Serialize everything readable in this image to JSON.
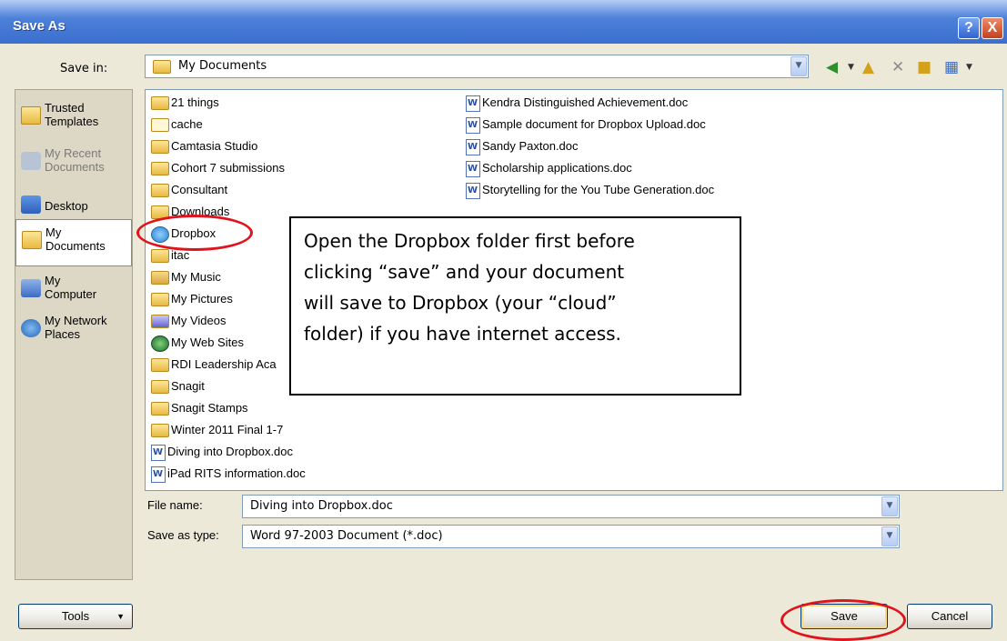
{
  "window": {
    "title": "Save As",
    "help_label": "?",
    "close_label": "X"
  },
  "save_in": {
    "label": "Save in:",
    "value": "My Documents"
  },
  "toolbar": {
    "back_icon": "back-icon",
    "up_icon": "up-folder-icon",
    "delete_icon": "delete-icon",
    "new_folder_icon": "new-folder-icon",
    "views_icon": "views-icon"
  },
  "places": [
    {
      "line1": "Trusted",
      "line2": "Templates"
    },
    {
      "line1": "My Recent",
      "line2": "Documents"
    },
    {
      "line1": "Desktop",
      "line2": ""
    },
    {
      "line1": "My",
      "line2": "Documents"
    },
    {
      "line1": "My",
      "line2": "Computer"
    },
    {
      "line1": "My Network",
      "line2": "Places"
    }
  ],
  "files_left": [
    "21 things",
    "cache",
    "Camtasia Studio",
    "Cohort 7 submissions",
    "Consultant",
    "Downloads",
    "Dropbox",
    "itac",
    "My Music",
    "My Pictures",
    "My Videos",
    "My Web Sites",
    "RDI Leadership Aca",
    "Snagit",
    "Snagit Stamps",
    "Winter 2011 Final 1-7",
    "Diving into Dropbox.doc",
    "iPad RITS information.doc"
  ],
  "files_right": [
    "Kendra Distinguished Achievement.doc",
    "Sample document for Dropbox Upload.doc",
    "Sandy Paxton.doc",
    "Scholarship applications.doc",
    "Storytelling for the You Tube Generation.doc"
  ],
  "callout": {
    "lines": [
      "Open the Dropbox folder first before",
      "clicking “save” and your document",
      "will save to Dropbox (your “cloud”",
      "folder) if you have internet access."
    ]
  },
  "file_name": {
    "label": "File name:",
    "value": "Diving into Dropbox.doc"
  },
  "save_type": {
    "label": "Save as type:",
    "value": "Word 97-2003 Document (*.doc)"
  },
  "buttons": {
    "tools": "Tools",
    "save": "Save",
    "cancel": "Cancel"
  },
  "colors": {
    "accent": "#3a6fcf",
    "annotation": "#e0141c"
  }
}
